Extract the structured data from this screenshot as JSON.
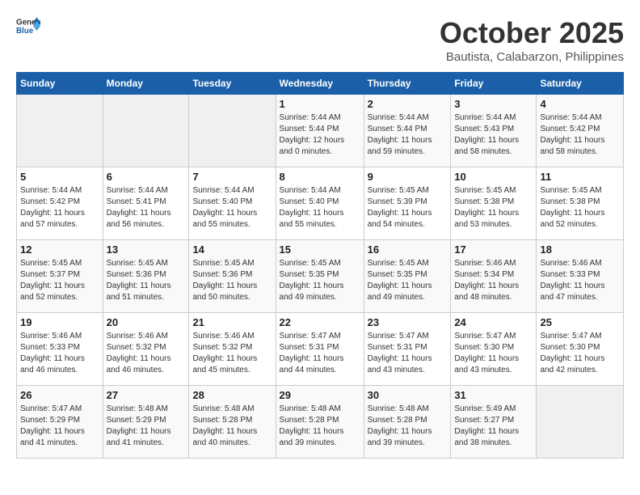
{
  "logo": {
    "text_general": "General",
    "text_blue": "Blue"
  },
  "title": "October 2025",
  "subtitle": "Bautista, Calabarzon, Philippines",
  "days_of_week": [
    "Sunday",
    "Monday",
    "Tuesday",
    "Wednesday",
    "Thursday",
    "Friday",
    "Saturday"
  ],
  "weeks": [
    [
      {
        "day": "",
        "info": ""
      },
      {
        "day": "",
        "info": ""
      },
      {
        "day": "",
        "info": ""
      },
      {
        "day": "1",
        "info": "Sunrise: 5:44 AM\nSunset: 5:44 PM\nDaylight: 12 hours\nand 0 minutes."
      },
      {
        "day": "2",
        "info": "Sunrise: 5:44 AM\nSunset: 5:44 PM\nDaylight: 11 hours\nand 59 minutes."
      },
      {
        "day": "3",
        "info": "Sunrise: 5:44 AM\nSunset: 5:43 PM\nDaylight: 11 hours\nand 58 minutes."
      },
      {
        "day": "4",
        "info": "Sunrise: 5:44 AM\nSunset: 5:42 PM\nDaylight: 11 hours\nand 58 minutes."
      }
    ],
    [
      {
        "day": "5",
        "info": "Sunrise: 5:44 AM\nSunset: 5:42 PM\nDaylight: 11 hours\nand 57 minutes."
      },
      {
        "day": "6",
        "info": "Sunrise: 5:44 AM\nSunset: 5:41 PM\nDaylight: 11 hours\nand 56 minutes."
      },
      {
        "day": "7",
        "info": "Sunrise: 5:44 AM\nSunset: 5:40 PM\nDaylight: 11 hours\nand 55 minutes."
      },
      {
        "day": "8",
        "info": "Sunrise: 5:44 AM\nSunset: 5:40 PM\nDaylight: 11 hours\nand 55 minutes."
      },
      {
        "day": "9",
        "info": "Sunrise: 5:45 AM\nSunset: 5:39 PM\nDaylight: 11 hours\nand 54 minutes."
      },
      {
        "day": "10",
        "info": "Sunrise: 5:45 AM\nSunset: 5:38 PM\nDaylight: 11 hours\nand 53 minutes."
      },
      {
        "day": "11",
        "info": "Sunrise: 5:45 AM\nSunset: 5:38 PM\nDaylight: 11 hours\nand 52 minutes."
      }
    ],
    [
      {
        "day": "12",
        "info": "Sunrise: 5:45 AM\nSunset: 5:37 PM\nDaylight: 11 hours\nand 52 minutes."
      },
      {
        "day": "13",
        "info": "Sunrise: 5:45 AM\nSunset: 5:36 PM\nDaylight: 11 hours\nand 51 minutes."
      },
      {
        "day": "14",
        "info": "Sunrise: 5:45 AM\nSunset: 5:36 PM\nDaylight: 11 hours\nand 50 minutes."
      },
      {
        "day": "15",
        "info": "Sunrise: 5:45 AM\nSunset: 5:35 PM\nDaylight: 11 hours\nand 49 minutes."
      },
      {
        "day": "16",
        "info": "Sunrise: 5:45 AM\nSunset: 5:35 PM\nDaylight: 11 hours\nand 49 minutes."
      },
      {
        "day": "17",
        "info": "Sunrise: 5:46 AM\nSunset: 5:34 PM\nDaylight: 11 hours\nand 48 minutes."
      },
      {
        "day": "18",
        "info": "Sunrise: 5:46 AM\nSunset: 5:33 PM\nDaylight: 11 hours\nand 47 minutes."
      }
    ],
    [
      {
        "day": "19",
        "info": "Sunrise: 5:46 AM\nSunset: 5:33 PM\nDaylight: 11 hours\nand 46 minutes."
      },
      {
        "day": "20",
        "info": "Sunrise: 5:46 AM\nSunset: 5:32 PM\nDaylight: 11 hours\nand 46 minutes."
      },
      {
        "day": "21",
        "info": "Sunrise: 5:46 AM\nSunset: 5:32 PM\nDaylight: 11 hours\nand 45 minutes."
      },
      {
        "day": "22",
        "info": "Sunrise: 5:47 AM\nSunset: 5:31 PM\nDaylight: 11 hours\nand 44 minutes."
      },
      {
        "day": "23",
        "info": "Sunrise: 5:47 AM\nSunset: 5:31 PM\nDaylight: 11 hours\nand 43 minutes."
      },
      {
        "day": "24",
        "info": "Sunrise: 5:47 AM\nSunset: 5:30 PM\nDaylight: 11 hours\nand 43 minutes."
      },
      {
        "day": "25",
        "info": "Sunrise: 5:47 AM\nSunset: 5:30 PM\nDaylight: 11 hours\nand 42 minutes."
      }
    ],
    [
      {
        "day": "26",
        "info": "Sunrise: 5:47 AM\nSunset: 5:29 PM\nDaylight: 11 hours\nand 41 minutes."
      },
      {
        "day": "27",
        "info": "Sunrise: 5:48 AM\nSunset: 5:29 PM\nDaylight: 11 hours\nand 41 minutes."
      },
      {
        "day": "28",
        "info": "Sunrise: 5:48 AM\nSunset: 5:28 PM\nDaylight: 11 hours\nand 40 minutes."
      },
      {
        "day": "29",
        "info": "Sunrise: 5:48 AM\nSunset: 5:28 PM\nDaylight: 11 hours\nand 39 minutes."
      },
      {
        "day": "30",
        "info": "Sunrise: 5:48 AM\nSunset: 5:28 PM\nDaylight: 11 hours\nand 39 minutes."
      },
      {
        "day": "31",
        "info": "Sunrise: 5:49 AM\nSunset: 5:27 PM\nDaylight: 11 hours\nand 38 minutes."
      },
      {
        "day": "",
        "info": ""
      }
    ]
  ]
}
